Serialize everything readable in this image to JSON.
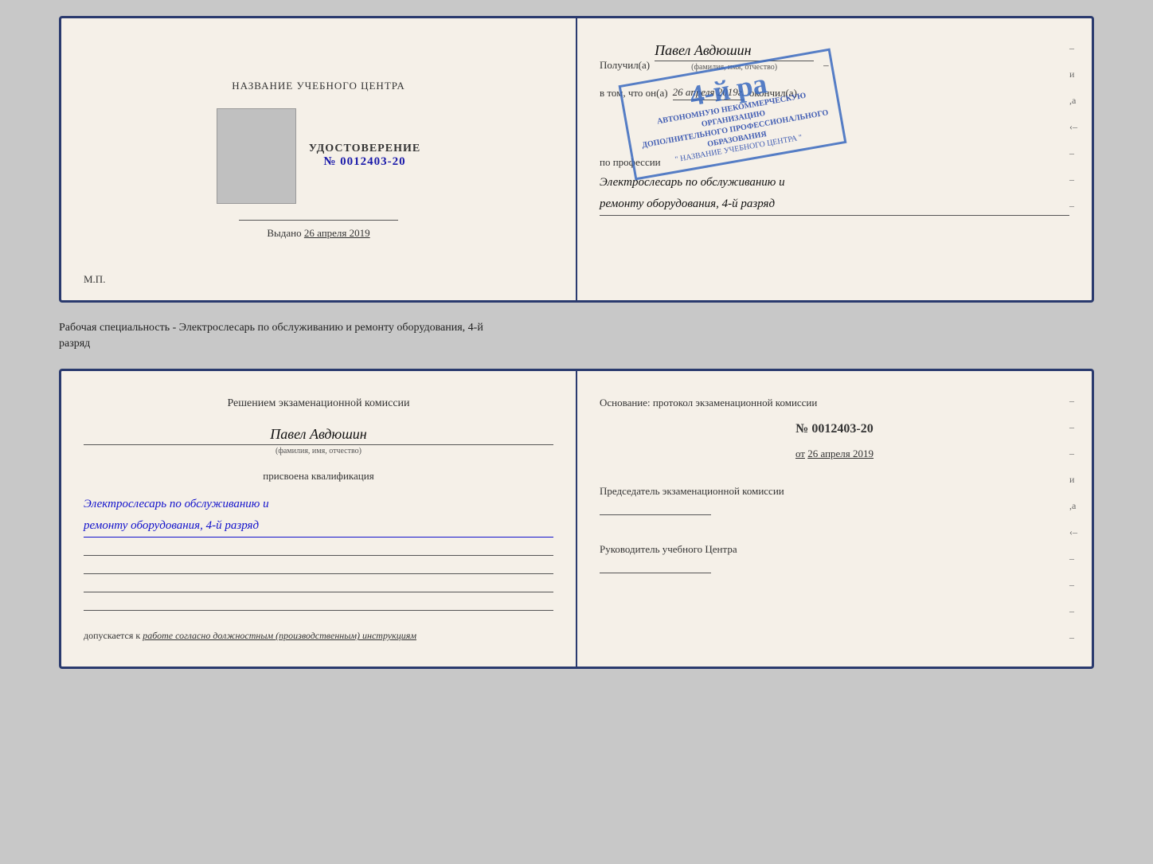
{
  "top_document": {
    "left_page": {
      "center_title": "НАЗВАНИЕ УЧЕБНОГО ЦЕНТРА",
      "photo_alt": "photo",
      "udostoverenie_title": "УДОСТОВЕРЕНИЕ",
      "udostoverenie_number": "№ 0012403-20",
      "vydano_label": "Выдано",
      "vydano_date": "26 апреля 2019",
      "mp_label": "М.П."
    },
    "right_page": {
      "poluchil_label": "Получил(а)",
      "person_name": "Павел Авдюшин",
      "fio_label": "(фамилия, имя, отчество)",
      "vtom_label": "в том, что он(а)",
      "date_text": "26 апреля 2019г.",
      "okonchil_label": "окончил(а)",
      "stamp_number": "4-й ра",
      "stamp_line1": "АВТОНОМНУЮ НЕКОММЕРЧЕСКУЮ ОРГАНИЗАЦИЮ",
      "stamp_line2": "ДОПОЛНИТЕЛЬНОГО ПРОФЕССИОНАЛЬНОГО ОБРАЗОВАНИЯ",
      "stamp_line3": "\" НАЗВАНИЕ УЧЕБНОГО ЦЕНТРА \"",
      "po_professii_label": "по профессии",
      "profession_line1": "Электрослесарь по обслуживанию и",
      "profession_line2": "ремонту оборудования, 4-й разряд",
      "side_chars": [
        "–",
        "и",
        ",а",
        "‹–",
        "–",
        "–",
        "–"
      ]
    }
  },
  "separator": {
    "text_line1": "Рабочая специальность - Электрослесарь по обслуживанию и ремонту оборудования, 4-й",
    "text_line2": "разряд"
  },
  "bottom_document": {
    "left_page": {
      "resheniem_title": "Решением экзаменационной комиссии",
      "person_name": "Павел Авдюшин",
      "fio_label": "(фамилия, имя, отчество)",
      "prisvoena_label": "присвоена квалификация",
      "qualification_line1": "Электрослесарь по обслуживанию и",
      "qualification_line2": "ремонту оборудования, 4-й разряд",
      "dopuskaetsya_prefix": "допускается к",
      "dopuskaetsya_italic": "работе согласно должностным (производственным) инструкциям"
    },
    "right_page": {
      "osnovanie_text": "Основание: протокол экзаменационной комиссии",
      "protocol_number": "№ 0012403-20",
      "ot_label": "от",
      "ot_date": "26 апреля 2019",
      "predsedatel_title": "Председатель экзаменационной комиссии",
      "rukovoditel_title": "Руководитель учебного Центра",
      "side_chars": [
        "–",
        "–",
        "–",
        "и",
        ",а",
        "‹–",
        "–",
        "–",
        "–",
        "–"
      ]
    }
  }
}
